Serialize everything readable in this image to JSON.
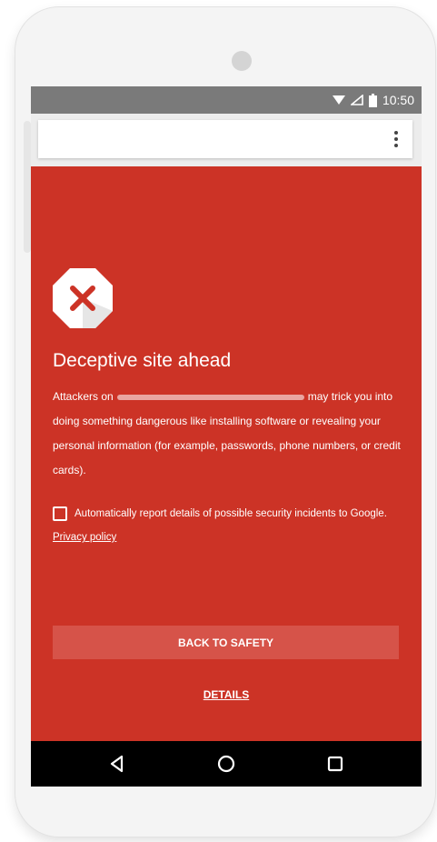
{
  "status_bar": {
    "time": "10:50",
    "icons": [
      "wifi-icon",
      "signal-icon",
      "battery-icon"
    ]
  },
  "browser": {
    "menu_icon": "overflow-menu-icon"
  },
  "warning": {
    "icon": "close-icon",
    "title": "Deceptive site ahead",
    "body_prefix": "Attackers on",
    "body_suffix": "may trick you into doing something dangerous like installing software or revealing your personal information (for example, passwords, phone numbers, or credit cards).",
    "report_label": "Automatically report details of possible security incidents to Google.",
    "report_checked": false,
    "privacy_link": "Privacy policy",
    "back_button": "BACK TO SAFETY",
    "details_link": "DETAILS"
  },
  "nav_bar": {
    "buttons": [
      "back-triangle-icon",
      "home-circle-icon",
      "recents-square-icon"
    ]
  },
  "colors": {
    "warning_background": "#cc3326",
    "button_background": "#d65349",
    "status_bar": "#7a7a7a",
    "nav_bar": "#000000"
  }
}
